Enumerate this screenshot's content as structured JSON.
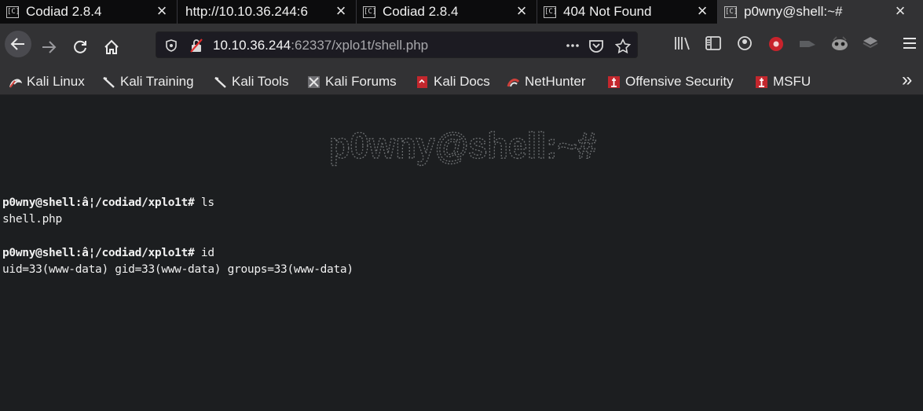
{
  "tabs": [
    {
      "favicon": "[C]",
      "title": "Codiad 2.8.4",
      "close": "×"
    },
    {
      "favicon": "",
      "title": "http://10.10.36.244:6",
      "close": "×"
    },
    {
      "favicon": "[C]",
      "title": "Codiad 2.8.4",
      "close": "×"
    },
    {
      "favicon": "[C]",
      "title": "404 Not Found",
      "close": "×"
    },
    {
      "favicon": "[C]",
      "title": "p0wny@shell:~#",
      "close": "×"
    }
  ],
  "address": {
    "host": "10.10.36.244",
    "rest": ":62337/xplo1t/shell.php"
  },
  "bookmarks": [
    {
      "label": "Kali Linux",
      "icon": "kali-dragon-icon"
    },
    {
      "label": "Kali Training",
      "icon": "kali-training-icon"
    },
    {
      "label": "Kali Tools",
      "icon": "kali-tools-icon"
    },
    {
      "label": "Kali Forums",
      "icon": "kali-forums-icon"
    },
    {
      "label": "Kali Docs",
      "icon": "kali-docs-icon"
    },
    {
      "label": "NetHunter",
      "icon": "nethunter-icon"
    },
    {
      "label": "Offensive Security",
      "icon": "offsec-icon"
    },
    {
      "label": "MSFU",
      "icon": "msfu-icon"
    }
  ],
  "overflow_glyph": "»",
  "colors": {
    "accent_red": "#e02d2d",
    "terminal_bg": "#1c1e20",
    "toolbar": "#323234"
  },
  "shell": {
    "logo": "p0wny@shell:~#",
    "lines": [
      {
        "prompt": "p0wny@shell:â¦/codiad/xplo1t#",
        "cmd": " ls"
      },
      {
        "output": "shell.php"
      },
      {
        "output": ""
      },
      {
        "prompt": "p0wny@shell:â¦/codiad/xplo1t#",
        "cmd": " id"
      },
      {
        "output": "uid=33(www-data) gid=33(www-data) groups=33(www-data)"
      }
    ]
  }
}
